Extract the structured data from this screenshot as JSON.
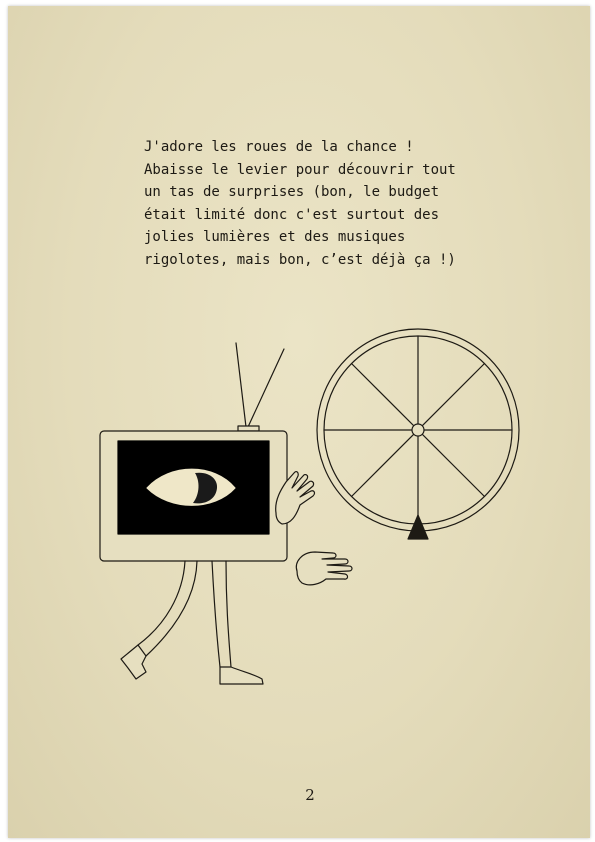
{
  "story": {
    "lines": [
      "J'adore les roues de la chance !",
      "Abaisse le levier pour découvrir tout",
      "un tas de surprises (bon, le budget",
      "était limité donc c'est surtout des",
      "jolies lumières et des musiques",
      "rigolotes, mais bon, c’est déjà ça !)"
    ]
  },
  "page": {
    "number": "2"
  },
  "illustration": {
    "icons": [
      "tv-character-icon",
      "eye-icon",
      "hand-icon",
      "wheel-of-fortune-icon"
    ],
    "colors": {
      "ink": "#1d1a14",
      "paper": "#e6dfc0",
      "screen": "#000000",
      "eye": "#efe7c8"
    }
  }
}
